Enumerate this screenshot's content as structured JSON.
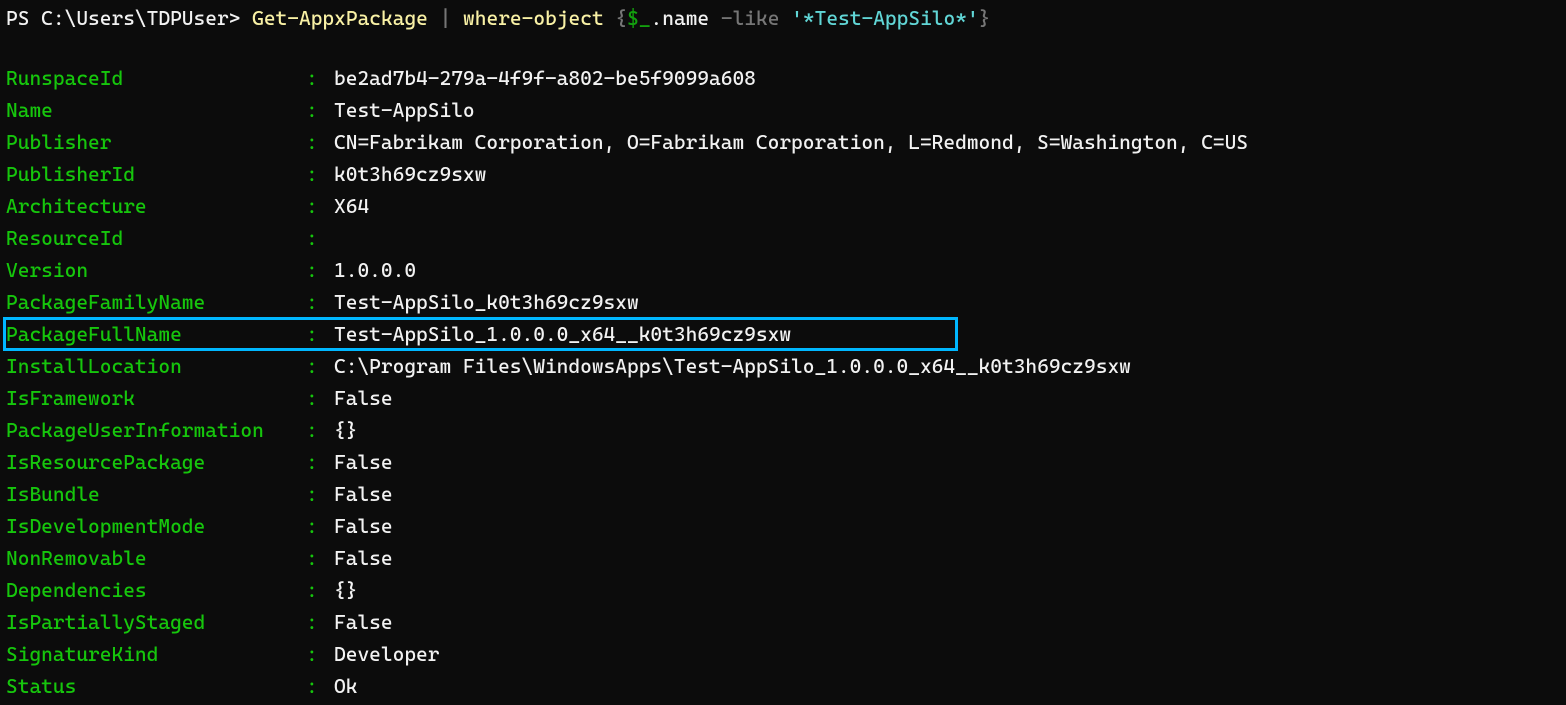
{
  "prompt": {
    "prefix": "PS C:\\Users\\TDPUser> ",
    "cmd1": "Get-AppxPackage",
    "pipe": " | ",
    "cmd2": "where-object",
    "brace_open": " {",
    "dollar_under": "$_",
    "dot_name": ".name",
    "operator": " -like ",
    "filter_string": "'*Test-AppSilo*'",
    "brace_close": "}"
  },
  "rows": [
    {
      "key": "RunspaceId",
      "value": "be2ad7b4-279a-4f9f-a802-be5f9099a608"
    },
    {
      "key": "Name",
      "value": "Test-AppSilo"
    },
    {
      "key": "Publisher",
      "value": "CN=Fabrikam Corporation, O=Fabrikam Corporation, L=Redmond, S=Washington, C=US"
    },
    {
      "key": "PublisherId",
      "value": "k0t3h69cz9sxw"
    },
    {
      "key": "Architecture",
      "value": "X64"
    },
    {
      "key": "ResourceId",
      "value": ""
    },
    {
      "key": "Version",
      "value": "1.0.0.0"
    },
    {
      "key": "PackageFamilyName",
      "value": "Test-AppSilo_k0t3h69cz9sxw"
    },
    {
      "key": "PackageFullName",
      "value": "Test-AppSilo_1.0.0.0_x64__k0t3h69cz9sxw",
      "highlight": true
    },
    {
      "key": "InstallLocation",
      "value": "C:\\Program Files\\WindowsApps\\Test-AppSilo_1.0.0.0_x64__k0t3h69cz9sxw"
    },
    {
      "key": "IsFramework",
      "value": "False"
    },
    {
      "key": "PackageUserInformation",
      "value": "{}"
    },
    {
      "key": "IsResourcePackage",
      "value": "False"
    },
    {
      "key": "IsBundle",
      "value": "False"
    },
    {
      "key": "IsDevelopmentMode",
      "value": "False"
    },
    {
      "key": "NonRemovable",
      "value": "False"
    },
    {
      "key": "Dependencies",
      "value": "{}"
    },
    {
      "key": "IsPartiallyStaged",
      "value": "False"
    },
    {
      "key": "SignatureKind",
      "value": "Developer"
    },
    {
      "key": "Status",
      "value": "Ok"
    }
  ]
}
